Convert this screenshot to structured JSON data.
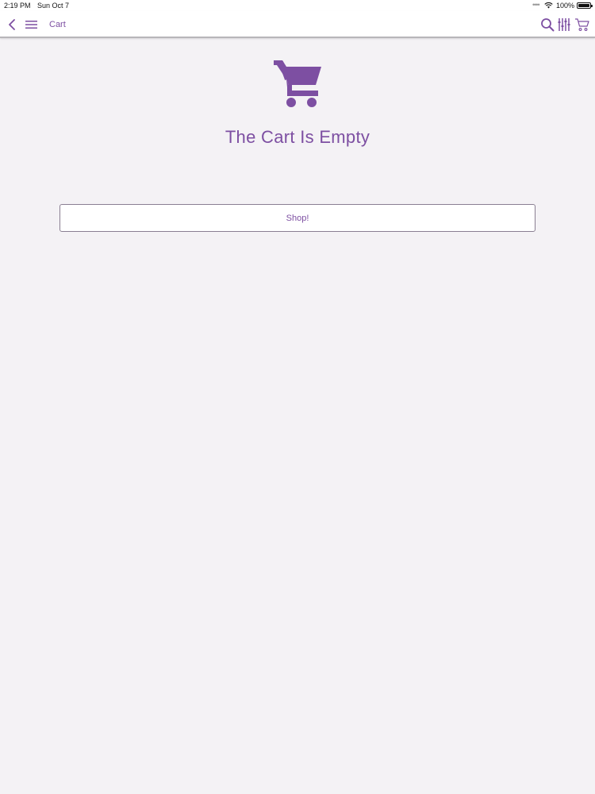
{
  "status_bar": {
    "time": "2:19 PM",
    "date": "Sun Oct 7",
    "battery": "100%"
  },
  "nav_bar": {
    "title": "Cart",
    "icons": [
      "chevron-left-icon",
      "hamburger-menu-icon",
      "search-icon",
      "sliders-icon",
      "cart-icon"
    ]
  },
  "main": {
    "empty_heading": "The Cart Is Empty",
    "shop_button_label": "Shop!"
  },
  "colors": {
    "accent": "#7d4fa2",
    "background": "#f4f2f5",
    "nav_background": "#ffffff"
  }
}
